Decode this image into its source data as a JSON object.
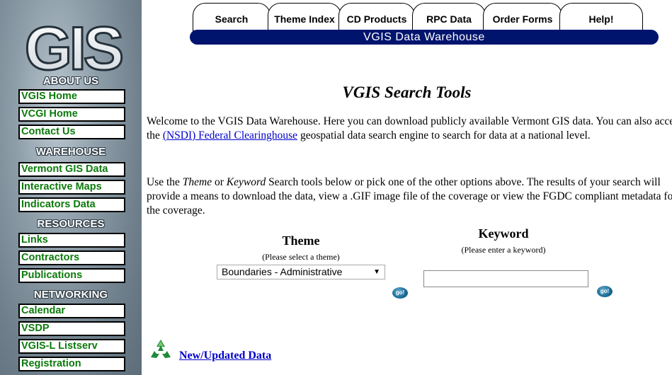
{
  "sidebar": {
    "logo_text": "GIS",
    "sections": [
      {
        "heading": "ABOUT US",
        "items": [
          "VGIS Home",
          "VCGI Home",
          "Contact Us"
        ]
      },
      {
        "heading": "WAREHOUSE",
        "items": [
          "Vermont GIS Data",
          "Interactive Maps",
          "Indicators Data"
        ]
      },
      {
        "heading": "RESOURCES",
        "items": [
          "Links",
          "Contractors",
          "Publications"
        ]
      },
      {
        "heading": "NETWORKING",
        "items": [
          "Calendar",
          "VSDP",
          "VGIS-L Listserv",
          "Registration"
        ]
      }
    ]
  },
  "tabs": [
    "Search",
    "Theme Index",
    "CD Products",
    "RPC Data",
    "Order Forms",
    "Help!"
  ],
  "banner": "VGIS Data Warehouse",
  "main": {
    "title": "VGIS Search Tools",
    "intro_before_link": "Welcome to the VGIS Data Warehouse. Here you can download publicly available Vermont GIS data. You can also access the ",
    "intro_link": "(NSDI) Federal Clearinghouse",
    "intro_after_link": " geospatial data search engine to search for data at a national level.",
    "para2_start": "Use the ",
    "para2_theme": "Theme",
    "para2_or": " or ",
    "para2_keyword": "Keyword",
    "para2_rest": " Search tools below or pick one of the other options above. The results of your search will provide a means to download the data, view a .GIF image file of the coverage or view the FGDC compliant metadata for the coverage."
  },
  "theme_search": {
    "label": "Theme",
    "hint": "(Please select a theme)",
    "selected": "Boundaries - Administrative",
    "go_label": "go!"
  },
  "keyword_search": {
    "label": "Keyword",
    "hint": "(Please enter a keyword)",
    "value": "",
    "go_label": "go!"
  },
  "new_data_link": "New/Updated Data",
  "colors": {
    "nav_text": "#0b7a0b",
    "banner_bg": "#00146e",
    "link": "#0000cc"
  }
}
